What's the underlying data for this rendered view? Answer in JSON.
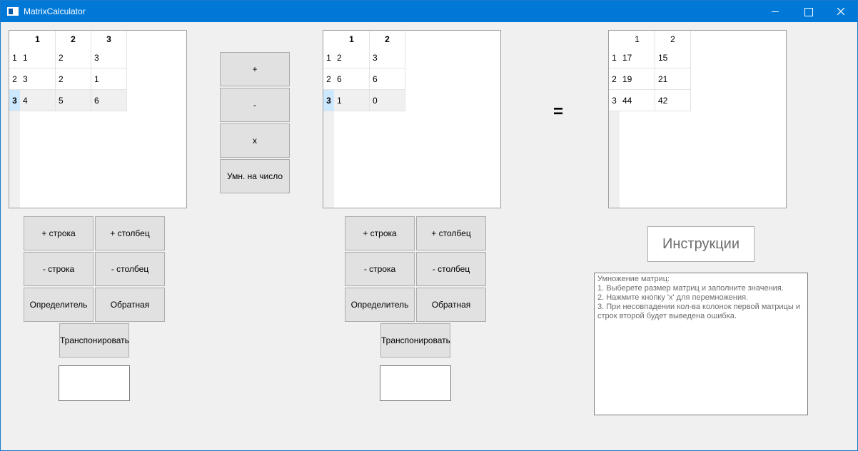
{
  "window": {
    "title": "MatrixCalculator"
  },
  "matrixA": {
    "columns": [
      "1",
      "2",
      "3"
    ],
    "rows": [
      "1",
      "2",
      "3"
    ],
    "cells": [
      [
        "1",
        "2",
        "3"
      ],
      [
        "3",
        "2",
        "1"
      ],
      [
        "4",
        "5",
        "6"
      ]
    ]
  },
  "matrixB": {
    "columns": [
      "1",
      "2"
    ],
    "rows": [
      "1",
      "2",
      "3"
    ],
    "cells": [
      [
        "2",
        "3"
      ],
      [
        "6",
        "6"
      ],
      [
        "1",
        "0"
      ]
    ]
  },
  "result": {
    "columns": [
      "1",
      "2"
    ],
    "rows": [
      "1",
      "2",
      "3"
    ],
    "cells": [
      [
        "17",
        "15"
      ],
      [
        "19",
        "21"
      ],
      [
        "44",
        "42"
      ]
    ]
  },
  "operations": {
    "add": "+",
    "subtract": "-",
    "multiply": "x",
    "scalar": "Умн. на число"
  },
  "matrixControls": {
    "add_row": "+ строка",
    "add_col": "+ столбец",
    "remove_row": "- строка",
    "remove_col": "- столбец",
    "determinant": "Определитель",
    "inverse": "Обратная",
    "transpose": "Транспонировать"
  },
  "equals": "=",
  "instructions": {
    "button_label": "Инструкции",
    "text": "Умножение матриц:\n1. Выберете размер матриц и заполните значения.\n2. Нажмите кнопку 'x' для перемножения.\n3. При несовпадении кол-ва колонок первой матрицы и строк второй будет выведена ошибка."
  }
}
